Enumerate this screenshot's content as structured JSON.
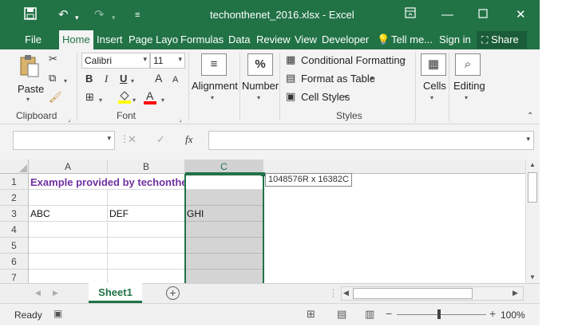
{
  "window": {
    "title": "techonthenet_2016.xlsx - Excel",
    "icons": [
      "save-icon",
      "undo-icon",
      "redo-icon",
      "customize-qat-icon",
      "ribbon-display-options-icon",
      "minimize-icon",
      "maximize-icon",
      "close-icon"
    ]
  },
  "tabs": [
    {
      "label": "File",
      "active": false
    },
    {
      "label": "Home",
      "active": true
    },
    {
      "label": "Insert",
      "active": false
    },
    {
      "label": "Page Layo",
      "active": false
    },
    {
      "label": "Formulas",
      "active": false
    },
    {
      "label": "Data",
      "active": false
    },
    {
      "label": "Review",
      "active": false
    },
    {
      "label": "View",
      "active": false
    },
    {
      "label": "Developer",
      "active": false
    }
  ],
  "tell_me": "Tell me...",
  "sign_in": "Sign in",
  "share": "Share",
  "ribbon": {
    "clipboard": {
      "paste": "Paste",
      "label": "Clipboard"
    },
    "font": {
      "name": "Calibri",
      "size": "11",
      "label": "Font",
      "bold": "B",
      "italic": "I",
      "underline": "U",
      "grow": "A",
      "shrink": "A",
      "font_color": "A"
    },
    "alignment": {
      "label": "Alignment"
    },
    "number": {
      "label": "Number",
      "icon_text": "%"
    },
    "styles": {
      "conditional_formatting": "Conditional Formatting",
      "format_as_table": "Format as Table",
      "cell_styles": "Cell Styles",
      "label": "Styles"
    },
    "cells": {
      "label": "Cells"
    },
    "editing": {
      "label": "Editing"
    }
  },
  "formula_bar": {
    "fx": "fx",
    "name_box": "",
    "value": ""
  },
  "grid": {
    "columns": [
      "A",
      "B",
      "C"
    ],
    "selected_column": "C",
    "rows": [
      "1",
      "2",
      "3",
      "4",
      "5",
      "6",
      "7"
    ],
    "cells": {
      "A1": "Example provided by techonthenet.com",
      "A3": "ABC",
      "B3": "DEF",
      "C3": "GHI"
    },
    "selection_tooltip": "1048576R x 16382C"
  },
  "sheets": [
    {
      "name": "Sheet1",
      "active": true
    }
  ],
  "status": {
    "text": "Ready",
    "zoom": "100%"
  },
  "colors": {
    "accent": "#217346",
    "a1_text": "#7030a0",
    "font_color_bar": "#ff0000",
    "highlight_bar": "#ffff00"
  }
}
